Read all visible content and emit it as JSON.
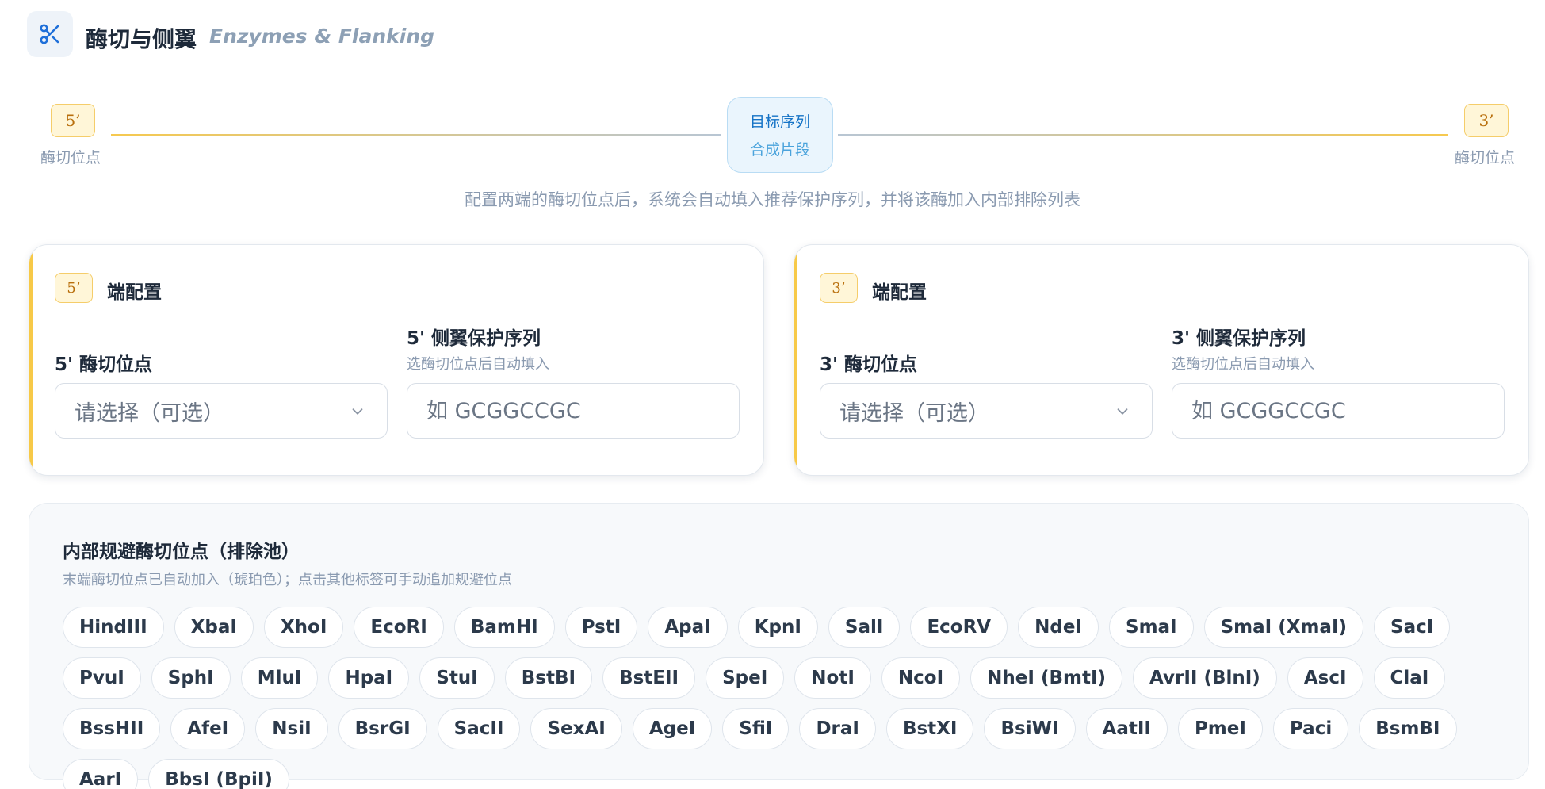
{
  "header": {
    "icon": "scissors-icon",
    "title": "酶切与侧翼",
    "subtitle": "Enzymes & Flanking"
  },
  "diagram": {
    "left_badge": "5’",
    "left_label": "酶切位点",
    "target_title": "目标序列",
    "target_sub": "合成片段",
    "right_badge": "3’",
    "right_label": "酶切位点",
    "hint": "配置两端的酶切位点后，系统会自动填入推荐保护序列，并将该酶加入内部排除列表"
  },
  "card5": {
    "badge": "5’",
    "title": "端配置",
    "site_label": "5' 酶切位点",
    "site_select": "请选择（可选）",
    "flank_label": "5' 侧翼保护序列",
    "flank_help": "选酶切位点后自动填入",
    "flank_placeholder": "如 GCGGCCGC"
  },
  "card3": {
    "badge": "3’",
    "title": "端配置",
    "site_label": "3' 酶切位点",
    "site_select": "请选择（可选）",
    "flank_label": "3' 侧翼保护序列",
    "flank_help": "选酶切位点后自动填入",
    "flank_placeholder": "如 GCGGCCGC"
  },
  "pool": {
    "title": "内部规避酶切位点（排除池）",
    "subtitle": "末端酶切位点已自动加入（琥珀色）；点击其他标签可手动追加规避位点",
    "tags": [
      "HindIII",
      "XbaI",
      "XhoI",
      "EcoRI",
      "BamHI",
      "PstI",
      "ApaI",
      "KpnI",
      "SalI",
      "EcoRV",
      "NdeI",
      "SmaI",
      "SmaI (XmaI)",
      "SacI",
      "PvuI",
      "SphI",
      "MluI",
      "HpaI",
      "StuI",
      "BstBI",
      "BstEII",
      "SpeI",
      "NotI",
      "NcoI",
      "NheI (BmtI)",
      "AvrII (BlnI)",
      "AscI",
      "ClaI",
      "BssHII",
      "AfeI",
      "NsiI",
      "BsrGI",
      "SacII",
      "SexAI",
      "AgeI",
      "SfiI",
      "DraI",
      "BstXI",
      "BsiWI",
      "AatII",
      "PmeI",
      "Paci",
      "BsmBI",
      "AarI",
      "BbsI (BpiI)"
    ]
  }
}
